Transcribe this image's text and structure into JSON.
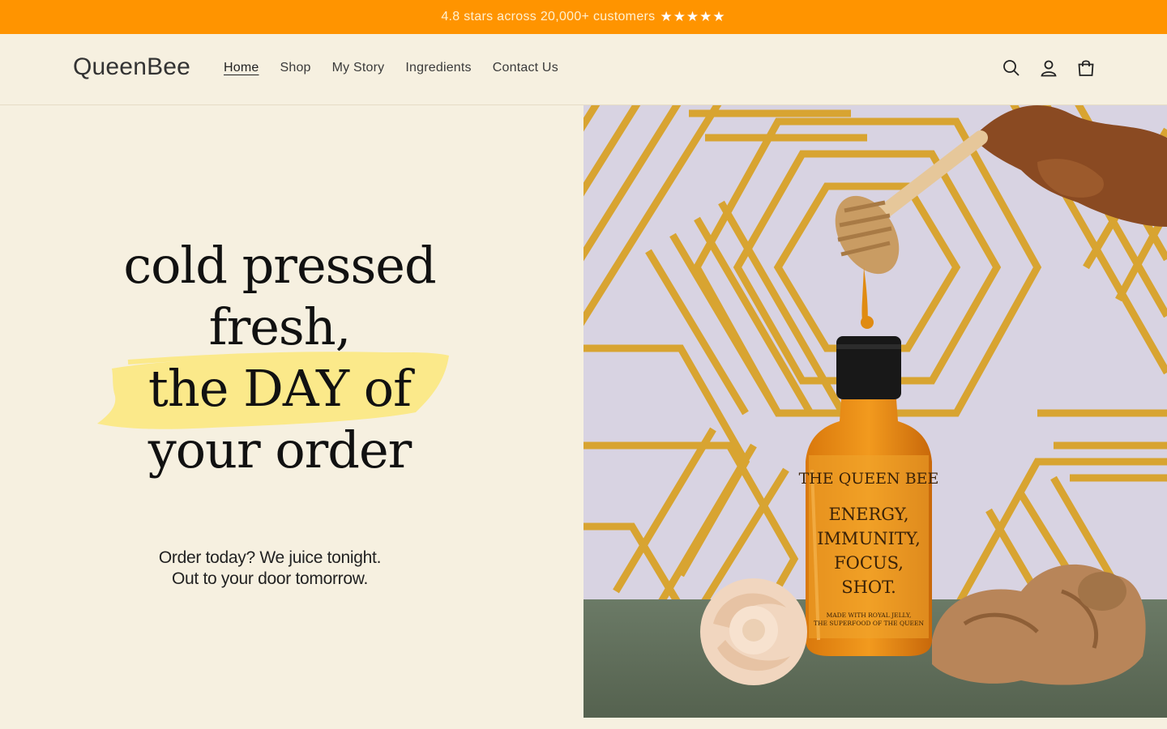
{
  "announcement": {
    "text": "4.8 stars across 20,000+ customers",
    "stars": "★★★★★"
  },
  "header": {
    "logo": "QueenBee",
    "nav": [
      {
        "label": "Home",
        "active": true
      },
      {
        "label": "Shop",
        "active": false
      },
      {
        "label": "My Story",
        "active": false
      },
      {
        "label": "Ingredients",
        "active": false
      },
      {
        "label": "Contact Us",
        "active": false
      }
    ],
    "icons": [
      "search-icon",
      "account-icon",
      "cart-icon"
    ]
  },
  "hero": {
    "headline": [
      "cold pressed",
      "fresh,",
      "the DAY of",
      "your order"
    ],
    "subtext": [
      "Order today? We juice tonight.",
      "Out to your door tomorrow."
    ],
    "image": {
      "bottle_label": [
        "THE QUEEN BEE",
        "ENERGY,",
        "IMMUNITY,",
        "FOCUS,",
        "SHOT.",
        "MADE WITH ROYAL JELLY,",
        "THE SUPERFOOD OF THE QUEEN"
      ]
    }
  },
  "colors": {
    "announcement_bg": "#ff9400",
    "page_bg": "#f6f0e0",
    "highlight": "#fbe98a"
  }
}
